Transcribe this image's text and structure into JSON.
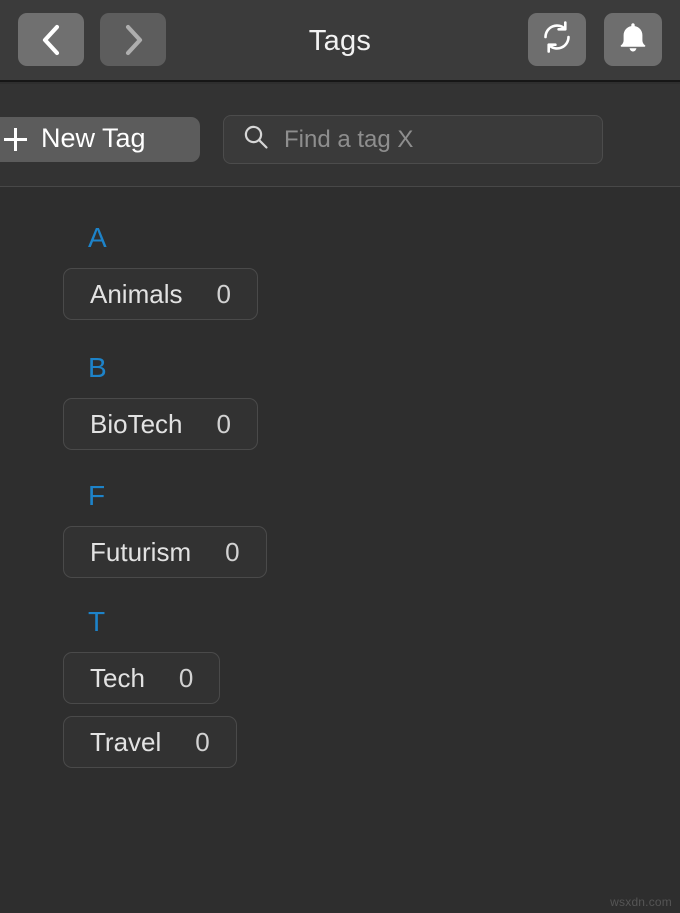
{
  "toolbar": {
    "title": "Tags",
    "back": {
      "icon": "chevron-left-icon",
      "enabled": true
    },
    "forward": {
      "icon": "chevron-right-icon",
      "enabled": false
    },
    "refresh": {
      "icon": "refresh-icon"
    },
    "notifications": {
      "icon": "bell-icon"
    }
  },
  "actionbar": {
    "new_tag_label": "New Tag",
    "new_tag_icon": "plus-icon",
    "search_icon": "search-icon",
    "search_placeholder": "Find a tag X",
    "search_value": ""
  },
  "colors": {
    "accent": "#1d83c9",
    "background": "#2e2e2e",
    "toolbar": "#3b3b3b",
    "actionbar": "#333333",
    "chip_border": "#4a4a4a"
  },
  "groups": [
    {
      "letter": "A",
      "tags": [
        {
          "name": "Animals",
          "count": "0"
        }
      ]
    },
    {
      "letter": "B",
      "tags": [
        {
          "name": "BioTech",
          "count": "0"
        }
      ]
    },
    {
      "letter": "F",
      "tags": [
        {
          "name": "Futurism",
          "count": "0"
        }
      ]
    },
    {
      "letter": "T",
      "tags": [
        {
          "name": "Tech",
          "count": "0"
        },
        {
          "name": "Travel",
          "count": "0"
        }
      ]
    }
  ],
  "watermark": "wsxdn.com"
}
